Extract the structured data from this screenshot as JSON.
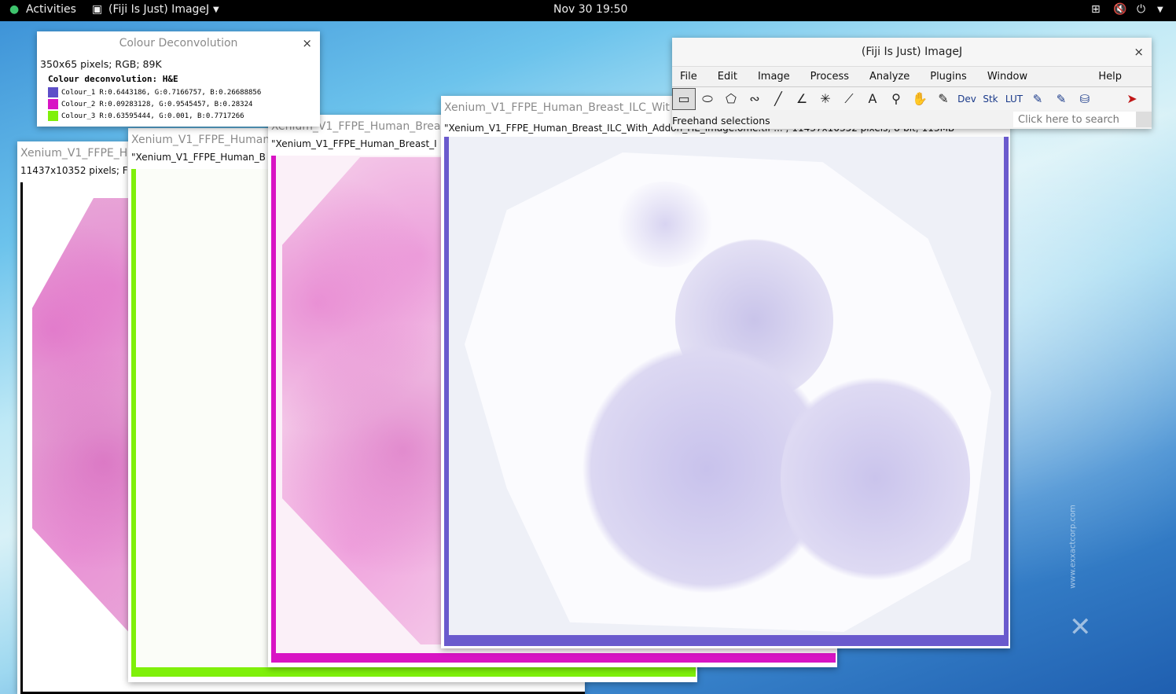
{
  "topbar": {
    "activities": "Activities",
    "app_menu": "(Fiji Is Just) ImageJ",
    "clock": "Nov 30  19:50"
  },
  "deconv": {
    "title": "Colour Deconvolution",
    "info": "350x65 pixels; RGB; 89K",
    "header": "Colour deconvolution: H&E",
    "rows": [
      {
        "label": "Colour_1",
        "values": "R:0.6443186,  G:0.7166757,  B:0.26688856",
        "color": "#5d4fc8"
      },
      {
        "label": "Colour_2",
        "values": "R:0.09283128,  G:0.9545457,  B:0.28324",
        "color": "#d814c4"
      },
      {
        "label": "Colour_3",
        "values": "R:0.63595444,  G:0.001,  B:0.7717266",
        "color": "#7ff00a"
      }
    ]
  },
  "img1": {
    "title": "Xenium_V1_FFPE_H",
    "info": "11437x10352 pixels; F"
  },
  "img2": {
    "title": "Xenium_V1_FFPE_Human",
    "info": "\"Xenium_V1_FFPE_Human_B"
  },
  "img3": {
    "title": "Xenium_V1_FFPE_Human_Breas",
    "info": "\"Xenium_V1_FFPE_Human_Breast_I"
  },
  "img4": {
    "title": "Xenium_V1_FFPE_Human_Breast_ILC_Wit",
    "info": "\"Xenium_V1_FFPE_Human_Breast_ILC_With_Addon_HE_image.ome.tif ... ; 11437x10352 pixels; 8-bit; 113MB"
  },
  "imagej": {
    "title": "(Fiji Is Just) ImageJ",
    "menu": [
      "File",
      "Edit",
      "Image",
      "Process",
      "Analyze",
      "Plugins",
      "Window",
      "Help"
    ],
    "status": "Freehand selections",
    "search_placeholder": "Click here to search",
    "tools": [
      "rectangle-tool-icon",
      "oval-tool-icon",
      "polygon-tool-icon",
      "freehand-tool-icon",
      "line-tool-icon",
      "angle-tool-icon",
      "point-tool-icon",
      "wand-tool-icon",
      "text-tool-icon",
      "magnifier-tool-icon",
      "hand-tool-icon",
      "color-picker-icon"
    ],
    "dev": "Dev",
    "stk": "Stk",
    "lut": "LUT"
  },
  "watermark": "www.exxactcorp.com"
}
